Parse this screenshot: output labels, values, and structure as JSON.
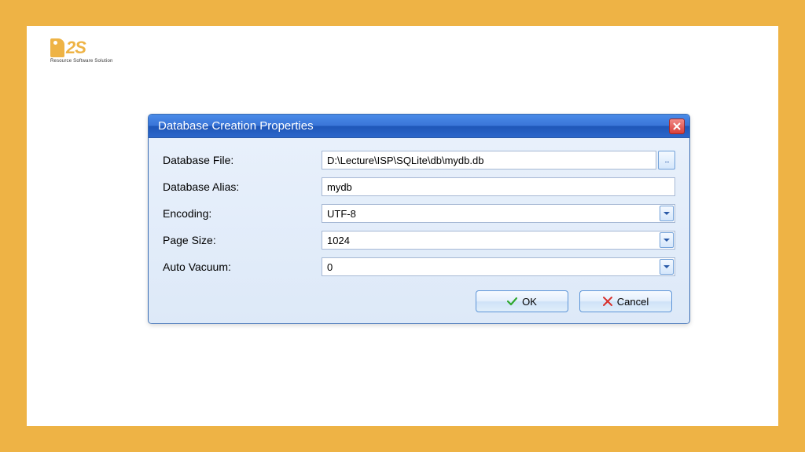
{
  "logo": {
    "text": "2S",
    "subtitle": "Resource Software Solution"
  },
  "dialog": {
    "title": "Database Creation Properties",
    "fields": {
      "db_file": {
        "label": "Database File:",
        "value": "D:\\Lecture\\ISP\\SQLite\\db\\mydb.db"
      },
      "db_alias": {
        "label": "Database Alias:",
        "value": "mydb"
      },
      "encoding": {
        "label": "Encoding:",
        "value": "UTF-8"
      },
      "page_size": {
        "label": "Page Size:",
        "value": "1024"
      },
      "auto_vacuum": {
        "label": "Auto Vacuum:",
        "value": "0"
      }
    },
    "buttons": {
      "ok": "OK",
      "cancel": "Cancel"
    },
    "browse_dots": "..."
  }
}
